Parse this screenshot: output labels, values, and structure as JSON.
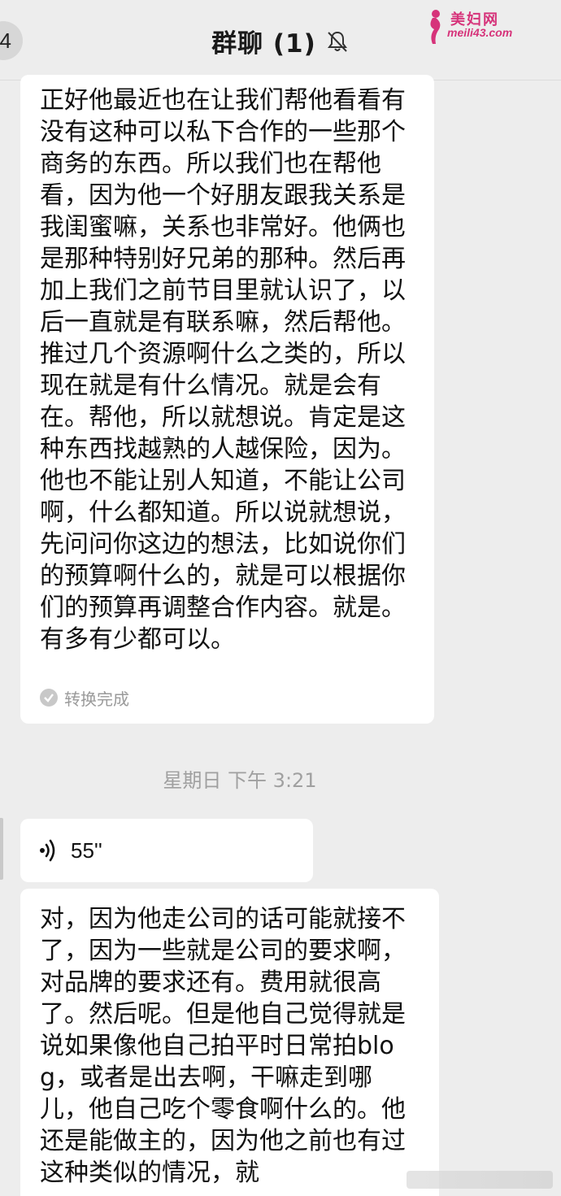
{
  "header": {
    "back_count": "4",
    "title": "群聊 (1)",
    "mute_icon": "bell-off-icon"
  },
  "watermark": {
    "site_name": "美妇网",
    "url": "meili43.com",
    "color": "#d6337a"
  },
  "messages": {
    "first": {
      "text": "正好他最近也在让我们帮他看看有没有这种可以私下合作的一些那个商务的东西。所以我们也在帮他看，因为他一个好朋友跟我关系是我闺蜜嘛，关系也非常好。他俩也是那种特别好兄弟的那种。然后再加上我们之前节目里就认识了，以后一直就是有联系嘛，然后帮他。推过几个资源啊什么之类的，所以现在就是有什么情况。就是会有在。帮他，所以就想说。肯定是这种东西找越熟的人越保险，因为。他也不能让别人知道，不能让公司啊，什么都知道。所以说就想说，先问问你这边的想法，比如说你们的预算啊什么的，就是可以根据你们的预算再调整合作内容。就是。有多有少都可以。",
      "status": "转换完成"
    },
    "timestamp": "星期日 下午 3:21",
    "voice": {
      "duration": "55''",
      "icon": "voice-wave-icon"
    },
    "second": {
      "text": "对，因为他走公司的话可能就接不了，因为一些就是公司的要求啊，对品牌的要求还有。费用就很高了。然后呢。但是他自己觉得就是说如果像他自己拍平时日常拍blog，或者是出去啊，干嘛走到哪儿，他自己吃个零食啊什么的。他还是能做主的，因为他之前也有过这种类似的情况，就"
    }
  },
  "colors": {
    "background": "#ededed",
    "bubble": "#ffffff",
    "muted_text": "#a0a0a0"
  }
}
